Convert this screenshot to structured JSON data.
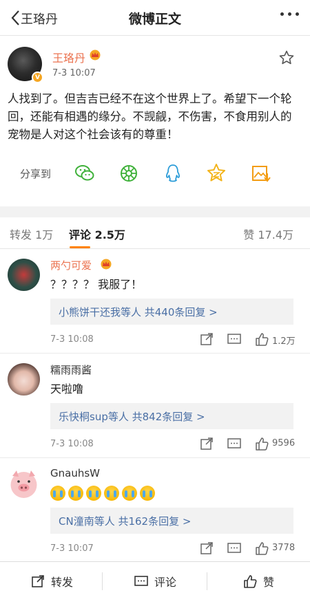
{
  "nav": {
    "back_author": "王珞丹",
    "title": "微博正文"
  },
  "post": {
    "author": "王珞丹",
    "time": "7-3 10:07",
    "content": "人找到了。但吉吉已经不在这个世界上了。希望下一个轮回，还能有相遇的缘分。不觊觎，不伤害，不食用别人的宠物是人对这个社会该有的尊重！",
    "share_label": "分享到",
    "share_targets": [
      "wechat-icon",
      "moments-icon",
      "qq-icon",
      "qzone-icon",
      "save-image-icon"
    ],
    "accent": "#eb7350"
  },
  "tabs": {
    "repost": "转发 1万",
    "comment": "评论 2.5万",
    "like": "赞 17.4万"
  },
  "comments": [
    {
      "name": "两勺可爱",
      "vip": true,
      "text": "？？？？ 我服了！",
      "reply_summary": "小熊饼干还我等人 共440条回复 >",
      "time": "7-3 10:08",
      "likes": "1.2万"
    },
    {
      "name": "糯雨雨酱",
      "vip": false,
      "text": "天啦噜",
      "reply_summary": "乐快桐sup等人 共842条回复 >",
      "time": "7-3 10:08",
      "likes": "9596"
    },
    {
      "name": "GnauhsW",
      "vip": false,
      "emoji": [
        "crying-emoji",
        "crying-emoji",
        "crying-emoji",
        "crying-emoji",
        "crying-emoji",
        "crying-emoji"
      ],
      "reply_summary": "CN潼南等人 共162条回复 >",
      "time": "7-3 10:07",
      "likes": "3778"
    }
  ],
  "bottom": {
    "repost": "转发",
    "comment": "评论",
    "like": "赞"
  }
}
